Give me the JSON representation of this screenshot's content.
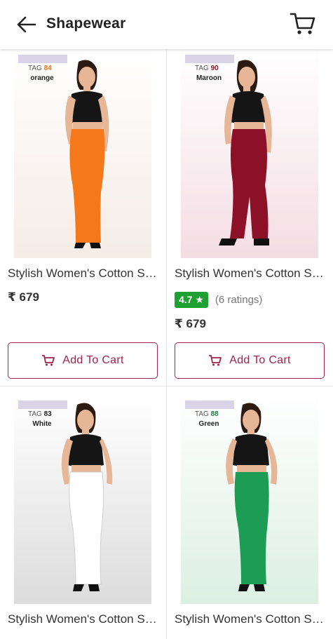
{
  "header": {
    "title": "Shapewear"
  },
  "colors": {
    "accent": "#a0234a",
    "rating": "#1fa033"
  },
  "products": [
    {
      "name": "Stylish Women's Cotton Saree Shapewear",
      "price": "₹ 679",
      "code_prefix": "TAG",
      "code": "84",
      "color_label": "orange",
      "skirt": "#f5781a",
      "bg": "#f5ece6",
      "code_color": "#e0781a",
      "button": "Add To Cart"
    },
    {
      "name": "Stylish Women's Cotton Saree Shapewear",
      "price": "₹ 679",
      "rating": "4.7 ★",
      "ratings_count": "(6 ratings)",
      "code_prefix": "TAG",
      "code": "90",
      "color_label": "Maroon",
      "skirt": "#8c1028",
      "bg": "#f4dde4",
      "code_color": "#8c1028",
      "button": "Add To Cart"
    },
    {
      "name": "Stylish Women's Cotton Saree Shapewear",
      "code_prefix": "TAG",
      "code": "83",
      "color_label": "White",
      "skirt": "#ffffff",
      "bg": "#dcdcdc",
      "code_color": "#222222"
    },
    {
      "name": "Stylish Women's Cotton Saree Shapewear",
      "code_prefix": "TAG",
      "code": "88",
      "color_label": "Green",
      "skirt": "#1d9c55",
      "bg": "#dcefe3",
      "code_color": "#1d7a44"
    }
  ]
}
